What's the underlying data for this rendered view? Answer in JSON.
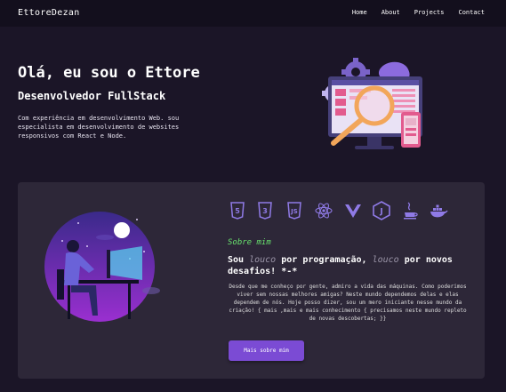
{
  "nav": {
    "brand": "EttoreDezan",
    "links": [
      "Home",
      "About",
      "Projects",
      "Contact"
    ]
  },
  "hero": {
    "greeting": "Olá, eu sou o Ettore",
    "role": "Desenvolvedor FullStack",
    "description": "Com experiência em desenvolvimento Web. sou especialista em desenvolvimento de websites responsivos com React e Node."
  },
  "about": {
    "label": "Sobre mim",
    "headline_start": "Sou",
    "headline_lc1": "louco",
    "headline_mid": "por programação,",
    "headline_lc2": "louco",
    "headline_end": "por novos desafios! *-*",
    "body": "Desde que me conheço por gente, admiro a vida das máquinas. Como poderimos viver sem nossas melhores amigas? Neste mundo dependemos delas e elas dependem de nós. Hoje posso dizer, sou um mero iniciante nesse mundo da criação! { mais ,mais e mais conhecimento { precisamos neste mundo repleto de novas descobertas; }}",
    "button_label": "Mais sobre mim"
  },
  "tech_icons": [
    "html5-icon",
    "css3-icon",
    "javascript-icon",
    "react-icon",
    "vue-icon",
    "nodejs-icon",
    "java-icon",
    "docker-icon"
  ],
  "colors": {
    "background": "#1b1527",
    "nav": "#130f1d",
    "card": "#2d2738",
    "accent": "#7b4bd4",
    "label_green": "#69e36e"
  }
}
